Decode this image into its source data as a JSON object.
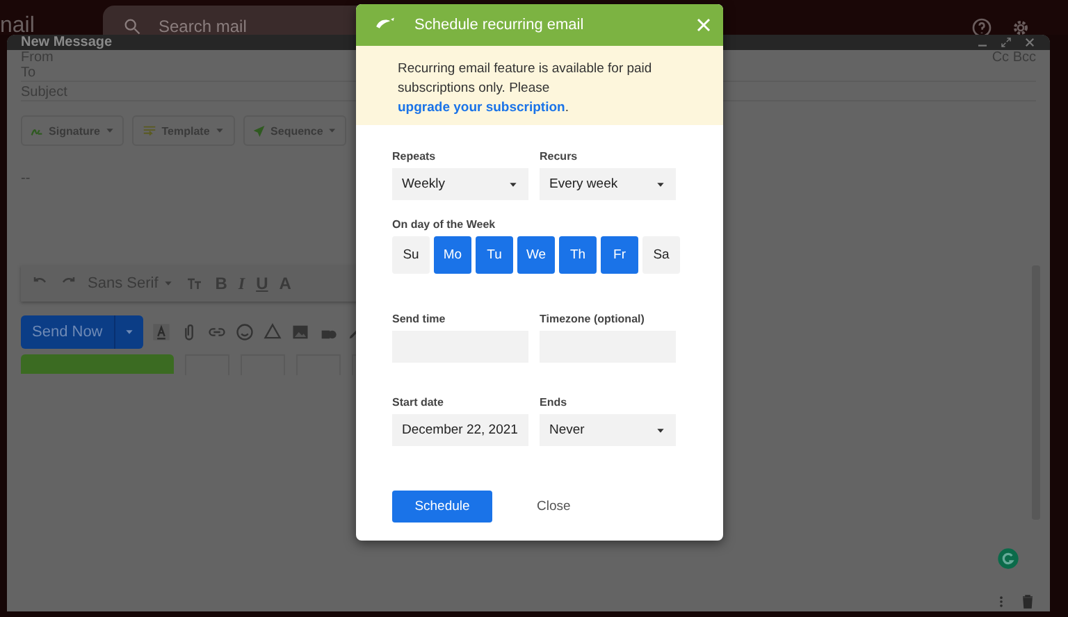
{
  "topbar": {
    "app_name": "nail",
    "search_placeholder": "Search mail"
  },
  "compose": {
    "title": "New Message",
    "cc_bcc": "Cc Bcc",
    "fields": [
      {
        "label": "From"
      },
      {
        "label": "To"
      },
      {
        "label": "Subject"
      }
    ],
    "tools": [
      {
        "label": "Signature",
        "kind": "signature"
      },
      {
        "label": "Template",
        "kind": "template"
      },
      {
        "label": "Sequence",
        "kind": "sequence"
      }
    ],
    "body": "--",
    "font": "Sans Serif",
    "format_buttons": [
      {
        "label": "B",
        "kind": "bold"
      },
      {
        "label": "I",
        "kind": "italic"
      },
      {
        "label": "U",
        "kind": "underline"
      },
      {
        "label": "A",
        "kind": "color"
      }
    ],
    "send": "Send Now"
  },
  "dialog": {
    "title": "Schedule recurring email",
    "notice": {
      "text": "Recurring email feature is available for paid subscriptions only. Please ",
      "link": "upgrade your subscription",
      "after": "."
    },
    "row1": [
      {
        "label": "Repeats",
        "kind": "select",
        "value": "Weekly"
      },
      {
        "label": "Recurs",
        "kind": "select",
        "value": "Every week"
      }
    ],
    "days_label": "On day of the Week",
    "days": [
      {
        "label": "Su",
        "selected": false
      },
      {
        "label": "Mo",
        "selected": true
      },
      {
        "label": "Tu",
        "selected": true
      },
      {
        "label": "We",
        "selected": true
      },
      {
        "label": "Th",
        "selected": true
      },
      {
        "label": "Fr",
        "selected": true
      },
      {
        "label": "Sa",
        "selected": false
      }
    ],
    "row2": [
      {
        "label": "Send time",
        "kind": "input"
      },
      {
        "label": "Timezone (optional)",
        "kind": "input"
      }
    ],
    "row3": [
      {
        "label": "Start date",
        "kind": "input",
        "value": "December 22, 2021"
      },
      {
        "label": "Ends",
        "kind": "select",
        "value": "Never"
      }
    ],
    "primary": "Schedule",
    "secondary": "Close"
  }
}
